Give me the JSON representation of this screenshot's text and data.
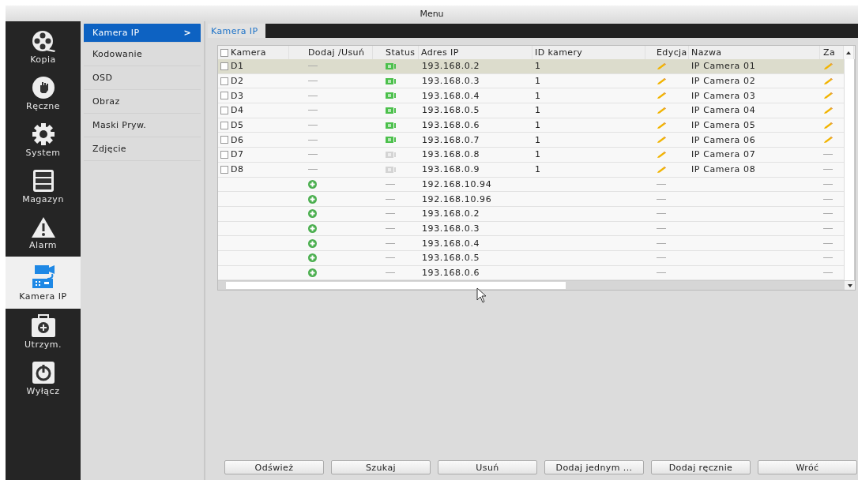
{
  "window": {
    "title": "Menu"
  },
  "nav": [
    {
      "label": "Kopia",
      "selected": false
    },
    {
      "label": "Ręczne",
      "selected": false
    },
    {
      "label": "System",
      "selected": false
    },
    {
      "label": "Magazyn",
      "selected": false
    },
    {
      "label": "Alarm",
      "selected": false
    },
    {
      "label": "Kamera IP",
      "selected": true
    },
    {
      "label": "Utrzym.",
      "selected": false
    },
    {
      "label": "Wyłącz",
      "selected": false
    }
  ],
  "submenu": [
    {
      "label": "Kamera IP",
      "arrow": ">",
      "selected": true
    },
    {
      "label": "Kodowanie",
      "selected": false
    },
    {
      "label": "OSD",
      "selected": false
    },
    {
      "label": "Obraz",
      "selected": false
    },
    {
      "label": "Maski Pryw.",
      "selected": false
    },
    {
      "label": "Zdjęcie",
      "selected": false
    }
  ],
  "tabs": [
    {
      "label": "Kamera IP",
      "selected": true
    }
  ],
  "table": {
    "all_checked": false,
    "columns": [
      "Kamera",
      "Dodaj /Usuń",
      "Status",
      "Adres IP",
      "ID kamery",
      "Edycja",
      "Nazwa",
      "Za"
    ],
    "rows": [
      {
        "kind": "device",
        "selected": true,
        "camera": "D1",
        "checked": false,
        "online": true,
        "ip": "193.168.0.2",
        "camera_id": "1",
        "edit": true,
        "name": "IP Camera 01",
        "column_8": true
      },
      {
        "kind": "device",
        "selected": false,
        "camera": "D2",
        "checked": false,
        "online": true,
        "ip": "193.168.0.3",
        "camera_id": "1",
        "edit": true,
        "name": "IP Camera 02",
        "column_8": true
      },
      {
        "kind": "device",
        "selected": false,
        "camera": "D3",
        "checked": false,
        "online": true,
        "ip": "193.168.0.4",
        "camera_id": "1",
        "edit": true,
        "name": "IP Camera 03",
        "column_8": true
      },
      {
        "kind": "device",
        "selected": false,
        "camera": "D4",
        "checked": false,
        "online": true,
        "ip": "193.168.0.5",
        "camera_id": "1",
        "edit": true,
        "name": "IP Camera 04",
        "column_8": true
      },
      {
        "kind": "device",
        "selected": false,
        "camera": "D5",
        "checked": false,
        "online": true,
        "ip": "193.168.0.6",
        "camera_id": "1",
        "edit": true,
        "name": "IP Camera 05",
        "column_8": true
      },
      {
        "kind": "device",
        "selected": false,
        "camera": "D6",
        "checked": false,
        "online": true,
        "ip": "193.168.0.7",
        "camera_id": "1",
        "edit": true,
        "name": "IP Camera 06",
        "column_8": true
      },
      {
        "kind": "device",
        "selected": false,
        "camera": "D7",
        "checked": false,
        "online": false,
        "ip": "193.168.0.8",
        "camera_id": "1",
        "edit": true,
        "name": "IP Camera 07",
        "column_8": false
      },
      {
        "kind": "device",
        "selected": false,
        "camera": "D8",
        "checked": false,
        "online": false,
        "ip": "193.168.0.9",
        "camera_id": "1",
        "edit": true,
        "name": "IP Camera 08",
        "column_8": false
      },
      {
        "kind": "found",
        "selected": false,
        "ip": "192.168.10.94",
        "edit": false,
        "column_8": false
      },
      {
        "kind": "found",
        "selected": false,
        "ip": "192.168.10.96",
        "edit": false,
        "column_8": false
      },
      {
        "kind": "found",
        "selected": false,
        "ip": "193.168.0.2",
        "edit": false,
        "column_8": false
      },
      {
        "kind": "found",
        "selected": false,
        "ip": "193.168.0.3",
        "edit": false,
        "column_8": false
      },
      {
        "kind": "found",
        "selected": false,
        "ip": "193.168.0.4",
        "edit": false,
        "column_8": false
      },
      {
        "kind": "found",
        "selected": false,
        "ip": "193.168.0.5",
        "edit": false,
        "column_8": false
      },
      {
        "kind": "found",
        "selected": false,
        "ip": "193.168.0.6",
        "edit": false,
        "column_8": false
      }
    ]
  },
  "buttons": [
    "Odśwież",
    "Szukaj",
    "Usuń",
    "Dodaj jednym ...",
    "Dodaj ręcznie",
    "Wróć"
  ]
}
